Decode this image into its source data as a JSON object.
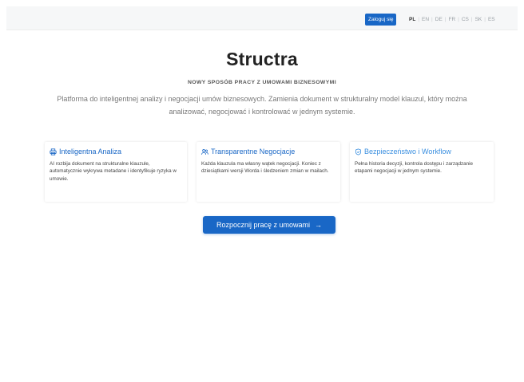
{
  "header": {
    "login_label": "Zaloguj się",
    "languages": [
      "PL",
      "EN",
      "DE",
      "FR",
      "CS",
      "SK",
      "ES"
    ],
    "active_language": "PL"
  },
  "hero": {
    "title": "Structra",
    "subtitle": "NOWY SPOSÓB PRACY Z UMOWAMI BIZNESOWYMI",
    "description": "Platforma do inteligentnej analizy i negocjacji umów biznesowych. Zamienia dokument w strukturalny model klauzul, który można analizować, negocjować i kontrolować w jednym systemie."
  },
  "features": [
    {
      "icon": "printer-icon",
      "title": "Inteligentna Analiza",
      "body": "AI rozbija dokument na strukturalne klauzule, automatycznie wykrywa metadane i identyfikuje ryzyka w umowie."
    },
    {
      "icon": "users-icon",
      "title": "Transparentne Negocjacje",
      "body": "Każda klauzula ma własny wątek negocjacji. Koniec z dziesiątkami wersji Worda i śledzeniem zmian w mailach."
    },
    {
      "icon": "shield-icon",
      "title": "Bezpieczeństwo i Workflow",
      "body": "Pełna historia decyzji, kontrola dostępu i zarządzanie etapami negocjacji w jednym systemie."
    }
  ],
  "cta": {
    "label": "Rozpocznij pracę z umowami",
    "arrow": "→"
  },
  "colors": {
    "accent": "#1967c6",
    "topbar_bg": "#f6f7f8"
  }
}
